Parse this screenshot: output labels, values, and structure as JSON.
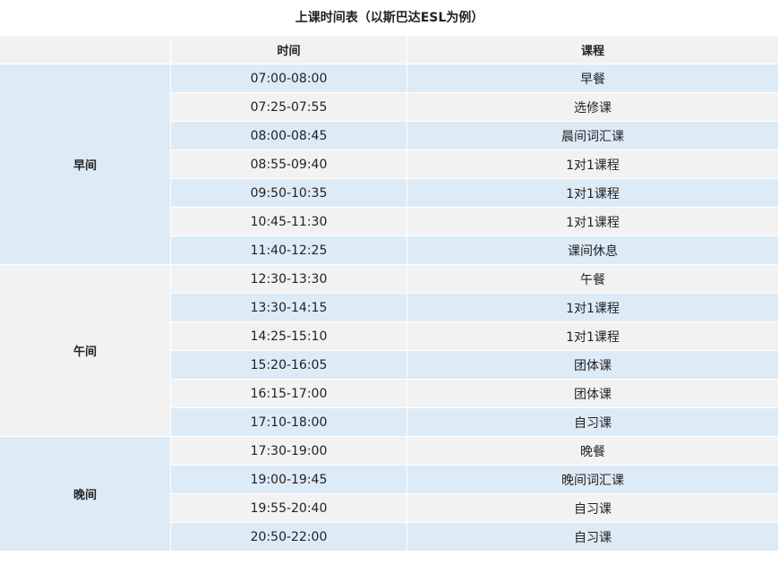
{
  "title": "上课时间表（以斯巴达ESL为例）",
  "headers": {
    "period": "",
    "time": "时间",
    "course": "课程"
  },
  "groups": [
    {
      "label": "早间",
      "rows": [
        {
          "time": "07:00-08:00",
          "course": "早餐"
        },
        {
          "time": "07:25-07:55",
          "course": "选修课"
        },
        {
          "time": "08:00-08:45",
          "course": "晨间词汇课"
        },
        {
          "time": "08:55-09:40",
          "course": "1对1课程"
        },
        {
          "time": "09:50-10:35",
          "course": "1对1课程"
        },
        {
          "time": "10:45-11:30",
          "course": "1对1课程"
        },
        {
          "time": "11:40-12:25",
          "course": "课间休息"
        }
      ]
    },
    {
      "label": "午间",
      "rows": [
        {
          "time": "12:30-13:30",
          "course": "午餐"
        },
        {
          "time": "13:30-14:15",
          "course": "1对1课程"
        },
        {
          "time": "14:25-15:10",
          "course": "1对1课程"
        },
        {
          "time": "15:20-16:05",
          "course": "团体课"
        },
        {
          "time": "16:15-17:00",
          "course": "团体课"
        },
        {
          "time": "17:10-18:00",
          "course": "自习课"
        }
      ]
    },
    {
      "label": "晚间",
      "rows": [
        {
          "time": "17:30-19:00",
          "course": "晚餐"
        },
        {
          "time": "19:00-19:45",
          "course": "晚间词汇课"
        },
        {
          "time": "19:55-20:40",
          "course": "自习课"
        },
        {
          "time": "20:50-22:00",
          "course": "自习课"
        }
      ]
    }
  ],
  "colors": {
    "row_blue": "#ddebf7",
    "row_gray": "#f2f2f2"
  }
}
